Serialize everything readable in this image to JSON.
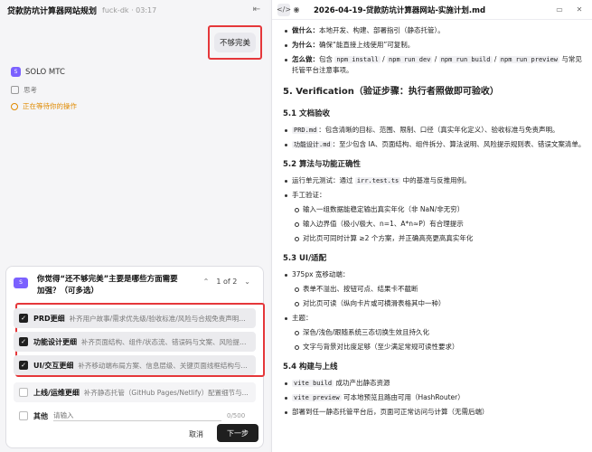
{
  "left": {
    "app_title": "贷款防坑计算器网站规划",
    "app_meta": "fuck-dk · 03:17",
    "user_message": "不够完美",
    "agent_name": "SOLO MTC",
    "agent_avatar": "S",
    "thinking": "思考",
    "waiting": "正在等待你的操作"
  },
  "question": {
    "text": "你觉得“还不够完美”主要是哪些方面需要加强？（可多选）",
    "pager": "1 of 2",
    "options": [
      {
        "label": "PRD更细",
        "desc": "补齐用户故事/需求优先级/验收标准/风险与合规免责声明等细节",
        "checked": true
      },
      {
        "label": "功能设计更细",
        "desc": "补齐页面结构、组件/状态流、错误码与文案、风险提示规则...",
        "checked": true
      },
      {
        "label": "UI/交互更细",
        "desc": "补齐移动端布局方案、信息层级、关键页面线框结构与文案...",
        "checked": true
      },
      {
        "label": "上线/运维更细",
        "desc": "补齐静态托管（GitHub Pages/Netlify）配置细节与...",
        "checked": false
      }
    ],
    "other_label": "其他",
    "other_placeholder": "请输入",
    "counter": "0/500",
    "cancel": "取消",
    "next": "下一步"
  },
  "editor": {
    "file_title": "2026-04-19-贷款防坑计算器网站-实施计划.md",
    "intro": [
      {
        "bold": "做什么：",
        "text": "本地开发、构建、部署指引（静态托管）。"
      },
      {
        "bold": "为什么：",
        "text": "确保“能直接上线使用”可复制。"
      }
    ],
    "how_bold": "怎么做：",
    "how_pre": "包含",
    "how_codes": [
      "npm install",
      "npm run dev",
      "npm run build",
      "npm run preview"
    ],
    "how_post": "与常见托管平台注意事项。",
    "h2": "5. Verification（验证步骤：执行者照做即可验收）",
    "s51": {
      "title": "5.1 文档验收",
      "items": [
        {
          "code": "PRD.md",
          "text": "：包含清晰的目标、范围、限制、口径（真实年化定义）、验收标准与免责声明。"
        },
        {
          "code": "功能设计.md",
          "text": "：至少包含 IA、页面结构、组件拆分、算法说明、风险提示规则表、错误文案清单。"
        }
      ]
    },
    "s52": {
      "title": "5.2 算法与功能正确性",
      "unit_pre": "运行单元测试：通过",
      "unit_code": "irr.test.ts",
      "unit_post": "中的基准与反推用例。",
      "manual": "手工验证：",
      "sub": [
        "输入一组数据能稳定输出真实年化（非 NaN/非无穷）",
        "输入边界值（极小/极大、n=1、A*n≈P）有合理提示",
        "对比页可同时计算 ≥2 个方案，并正确高亮更高真实年化"
      ]
    },
    "s53": {
      "title": "5.3 UI/适配",
      "w": "375px 宽移动端：",
      "w_sub": [
        "表单不溢出、按钮可点、结果卡不截断",
        "对比页可读（纵向卡片或可横滑表格其中一种）"
      ],
      "theme": "主题：",
      "theme_sub": [
        "深色/浅色/跟随系统三态切换生效且持久化",
        "文字与背景对比度足够（至少满足常规可读性要求）"
      ]
    },
    "s54": {
      "title": "5.4 构建与上线",
      "items": [
        {
          "code": "vite build",
          "text": "成功产出静态资源"
        },
        {
          "code": "vite preview",
          "text": "可本地预览且路由可用（HashRouter）"
        },
        {
          "code": "",
          "text": "部署到任一静态托管平台后，页面可正常访问与计算（无需后端）"
        }
      ]
    }
  }
}
